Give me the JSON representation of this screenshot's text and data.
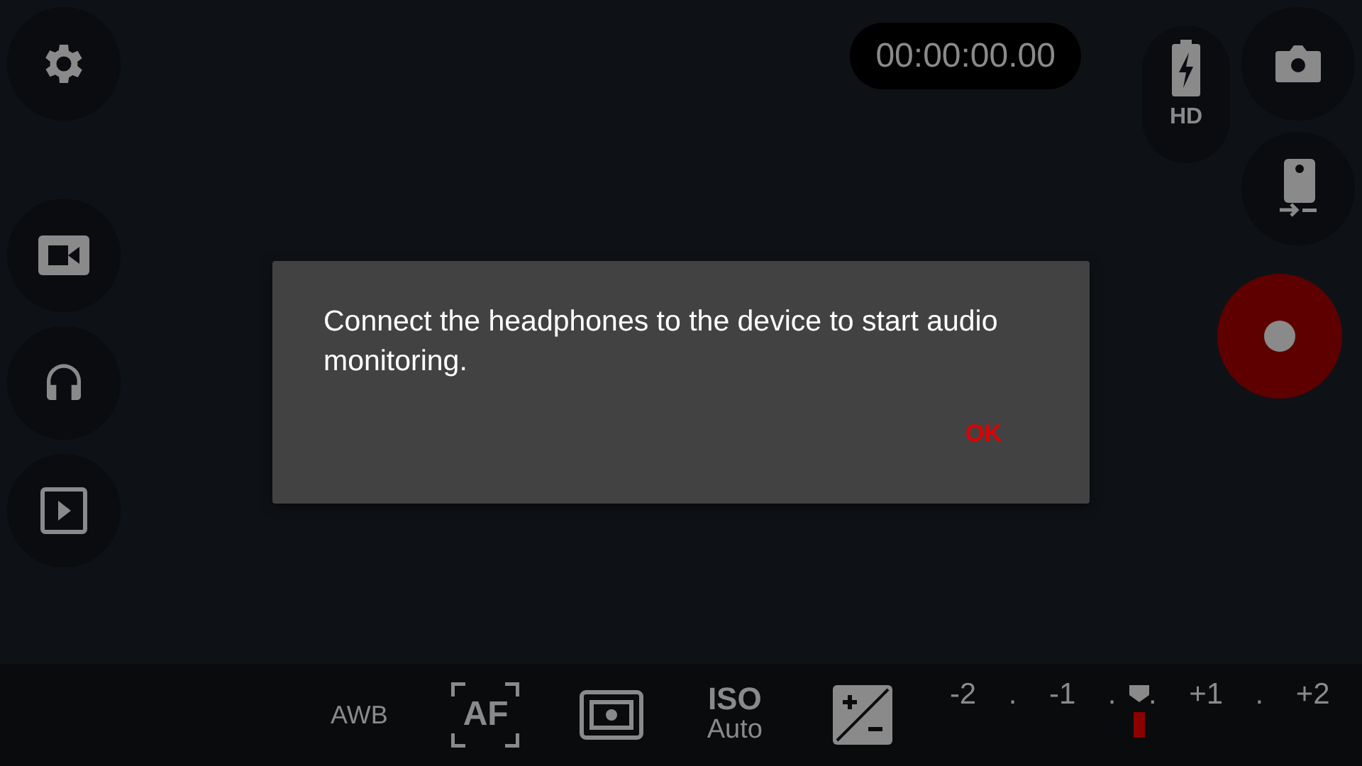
{
  "left_buttons": [
    {
      "kind": "settings"
    },
    {
      "kind": "video"
    },
    {
      "kind": "headphones"
    },
    {
      "kind": "gallery"
    }
  ],
  "timer": "00:00:00.00",
  "quality": {
    "label": "HD"
  },
  "right_buttons": [
    {
      "kind": "photo"
    },
    {
      "kind": "switch-camera"
    }
  ],
  "dialog": {
    "message": "Connect the headphones to the device to start audio monitoring.",
    "button": "OK"
  },
  "bottom_bar": {
    "white_balance": "AWB",
    "focus": "AF",
    "iso": {
      "label": "ISO",
      "value": "Auto"
    },
    "exposure": {
      "ticks": [
        "-2",
        ".",
        "-1",
        ".",
        ".",
        "+1",
        ".",
        "+2"
      ],
      "level": 0.5
    }
  }
}
